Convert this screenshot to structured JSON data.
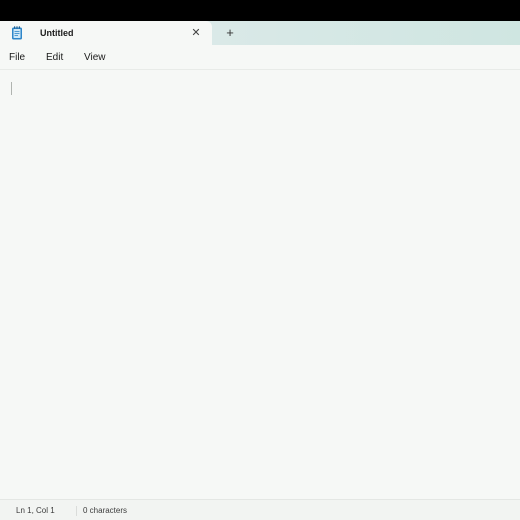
{
  "tab": {
    "title": "Untitled",
    "close_glyph": "✕",
    "icon": "notepad-icon"
  },
  "new_tab_glyph": "+",
  "menu": {
    "items": [
      {
        "label": "File"
      },
      {
        "label": "Edit"
      },
      {
        "label": "View"
      }
    ]
  },
  "editor": {
    "content": ""
  },
  "status": {
    "position": "Ln 1, Col 1",
    "characters": "0 characters"
  },
  "colors": {
    "window_bg": "#f6f8f6",
    "tab_strip_accent": "#cfe6e1",
    "notepad_icon": "#2f86c9"
  }
}
